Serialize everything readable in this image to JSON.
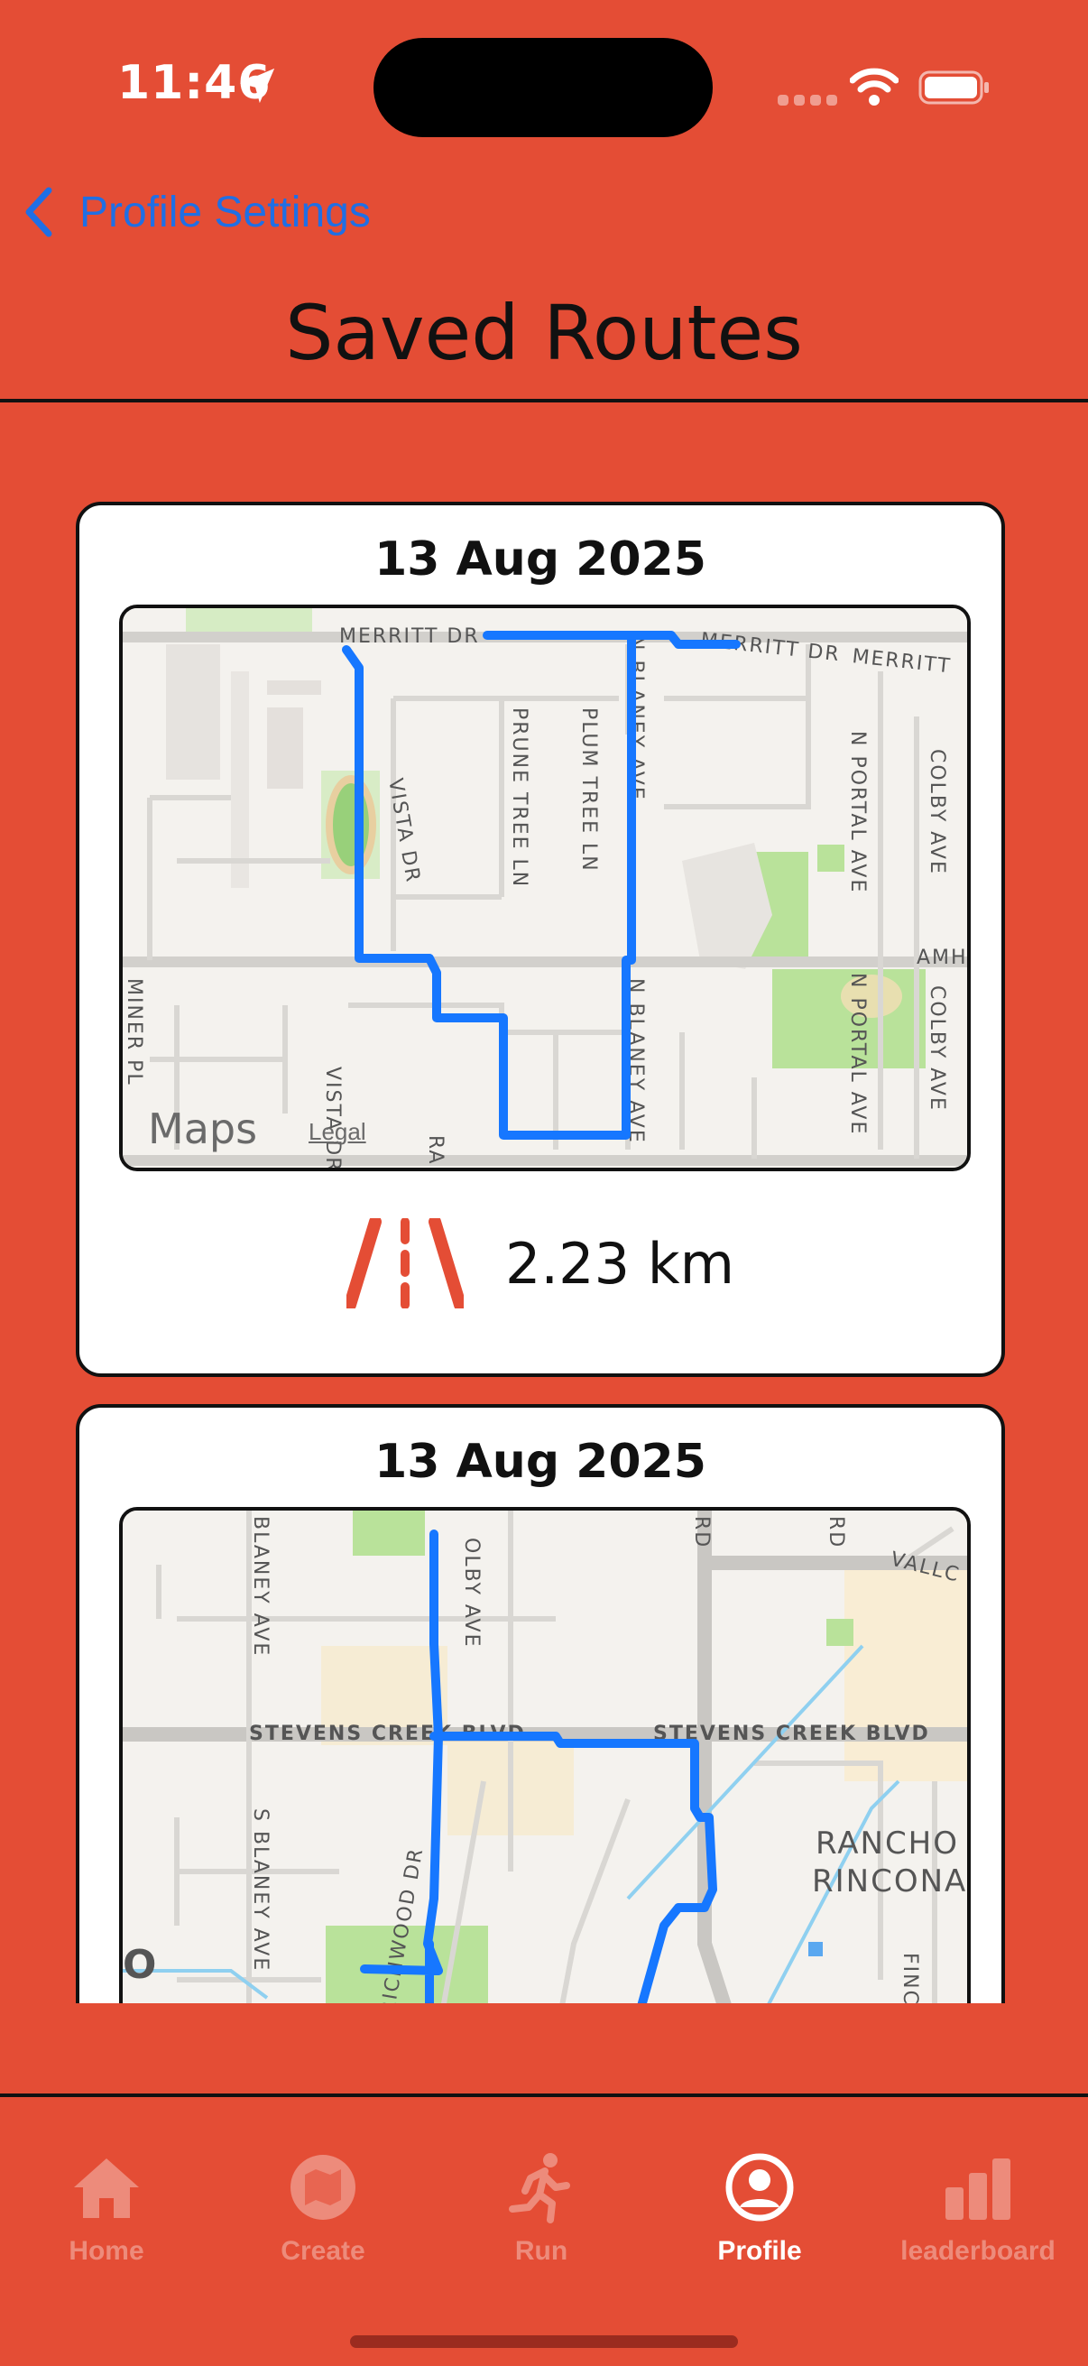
{
  "status_bar": {
    "time": "11:46"
  },
  "nav": {
    "back_label": "Profile Settings"
  },
  "page": {
    "title": "Saved Routes"
  },
  "routes": [
    {
      "date": "13 Aug 2025",
      "distance": "2.23 km",
      "map": {
        "streets": [
          "MERRITT DR",
          "MERRITT DR",
          "MERRITT",
          "VISTA DR",
          "PRUNE TREE LN",
          "PLUM TREE LN",
          "N BLANEY AVE",
          "N BLANEY AVE",
          "N PORTAL AVE",
          "N PORTAL AVE",
          "COLBY AVE",
          "COLBY AVE",
          "AMH",
          "MINER PL",
          "VISTA DR",
          "RA"
        ],
        "brand": "Maps",
        "legal": "Legal"
      }
    },
    {
      "date": "13 Aug 2025",
      "map": {
        "streets": [
          "STEVENS CREEK BLVD",
          "STEVENS CREEK BLVD",
          "BLANEY AVE",
          "S BLANEY AVE",
          "OLBY AVE",
          "RD",
          "RD",
          "VALLC",
          "RANCHO",
          "RINCONAD",
          "RICHWOOD DR",
          "DR",
          "FINC",
          "O"
        ]
      }
    }
  ],
  "tabs": [
    {
      "label": "Home",
      "icon": "house-icon"
    },
    {
      "label": "Create",
      "icon": "map-icon"
    },
    {
      "label": "Run",
      "icon": "runner-icon"
    },
    {
      "label": "Profile",
      "icon": "person-circle-icon",
      "active": true
    },
    {
      "label": "leaderboard",
      "icon": "bar-chart-icon"
    }
  ],
  "colors": {
    "background": "#e44d35",
    "accent": "#1f6fe5",
    "route": "#1677ff"
  }
}
